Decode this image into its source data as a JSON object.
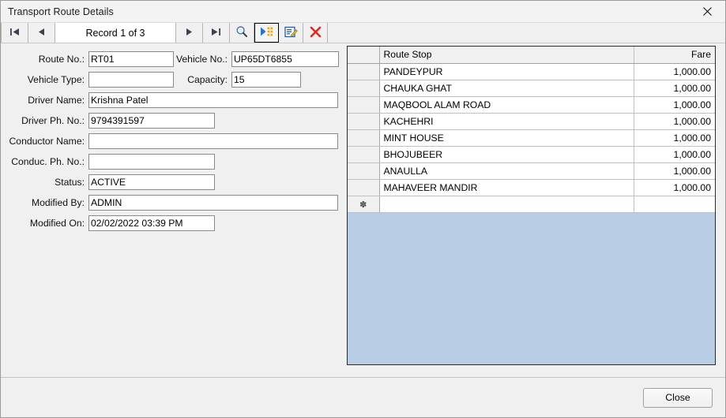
{
  "window": {
    "title": "Transport Route Details",
    "close_icon": "close-icon"
  },
  "toolbar": {
    "first_icon": "nav-first-icon",
    "prev_icon": "nav-prev-icon",
    "record_label": "Record 1 of 3",
    "next_icon": "nav-next-icon",
    "last_icon": "nav-last-icon",
    "search_icon": "magnifier-icon",
    "run_icon": "run-query-icon",
    "edit_icon": "edit-record-icon",
    "delete_icon": "delete-record-icon"
  },
  "form": {
    "route_no": {
      "label": "Route No.:",
      "value": "RT01"
    },
    "vehicle_no": {
      "label": "Vehicle No.:",
      "value": "UP65DT6855"
    },
    "vehicle_type": {
      "label": "Vehicle Type:",
      "value": ""
    },
    "capacity": {
      "label": "Capacity:",
      "value": "15"
    },
    "driver_name": {
      "label": "Driver Name:",
      "value": "Krishna Patel"
    },
    "driver_phone": {
      "label": "Driver Ph. No.:",
      "value": "9794391597"
    },
    "conductor_name": {
      "label": "Conductor Name:",
      "value": ""
    },
    "conductor_phone": {
      "label": "Conduc. Ph. No.:",
      "value": ""
    },
    "status": {
      "label": "Status:",
      "value": "ACTIVE"
    },
    "modified_by": {
      "label": "Modified By:",
      "value": "ADMIN"
    },
    "modified_on": {
      "label": "Modified On:",
      "value": "02/02/2022 03:39 PM"
    }
  },
  "grid": {
    "columns": [
      "",
      "Route Stop",
      "Fare"
    ],
    "rows": [
      {
        "stop": "PANDEYPUR",
        "fare": "1,000.00"
      },
      {
        "stop": "CHAUKA GHAT",
        "fare": "1,000.00"
      },
      {
        "stop": "MAQBOOL ALAM ROAD",
        "fare": "1,000.00"
      },
      {
        "stop": "KACHEHRI",
        "fare": "1,000.00"
      },
      {
        "stop": "MINT HOUSE",
        "fare": "1,000.00"
      },
      {
        "stop": "BHOJUBEER",
        "fare": "1,000.00"
      },
      {
        "stop": "ANAULLA",
        "fare": "1,000.00"
      },
      {
        "stop": "MAHAVEER MANDIR",
        "fare": "1,000.00"
      }
    ],
    "new_row_marker": "✽",
    "empty_area_color": "#b9cde5"
  },
  "footer": {
    "close_label": "Close"
  }
}
